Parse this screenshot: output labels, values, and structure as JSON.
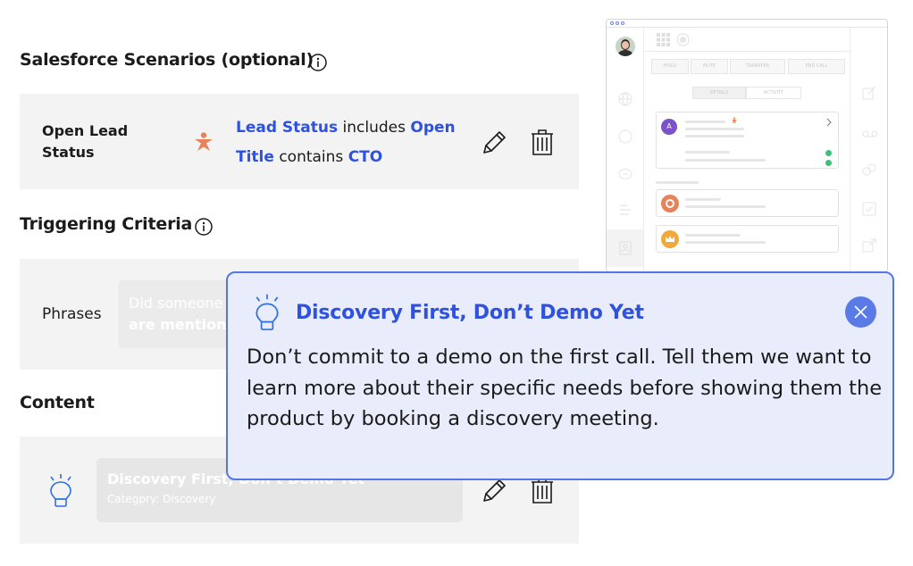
{
  "salesforce": {
    "title": "Salesforce Scenarios (optional)",
    "rule": {
      "name": "Open Lead Status",
      "line1_field": "Lead Status",
      "line1_op": " includes ",
      "line1_value": "Open",
      "line2_field": "Title",
      "line2_op": " contains ",
      "line2_value": "CTO"
    }
  },
  "triggering": {
    "title": "Triggering Criteria",
    "phrases_label": "Phrases",
    "phrase_line1": "Did someone",
    "phrase_line2": "are mentione"
  },
  "content": {
    "title": "Content",
    "item_title": "Discovery First, Don’t Demo Yet",
    "item_category": "Categpry: Discovery"
  },
  "app_mock": {
    "buttons": [
      "HOLD",
      "MUTE",
      "TRANSFER",
      "END CALL"
    ],
    "tabs": [
      "DETAILS",
      "ACTIVITY"
    ],
    "contact_initial": "A"
  },
  "tooltip": {
    "title": "Discovery First, Don’t Demo Yet",
    "body": "Don’t commit to a demo on the first call. Tell them we want to learn more about their specific needs before showing them the product by booking a discovery meeting."
  },
  "colors": {
    "accent_blue": "#2e51e0",
    "tooltip_bg": "#e9edfb",
    "tooltip_border": "#5476e6",
    "person_orange": "#e8825a",
    "card_bg": "#f3f3f3"
  },
  "icons": [
    "info-icon",
    "person-icon",
    "pencil-icon",
    "trash-icon",
    "lightbulb-icon",
    "close-icon",
    "avatar",
    "grid-icon",
    "globe-icon"
  ]
}
